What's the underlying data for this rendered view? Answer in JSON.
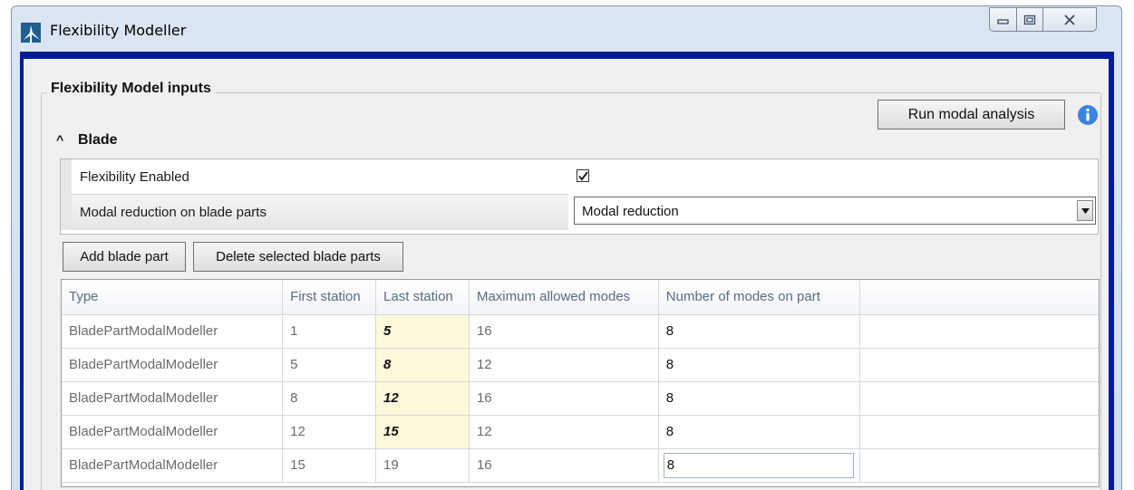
{
  "window": {
    "title": "Flexibility Modeller",
    "accent_color": "#001aa0"
  },
  "inputs": {
    "group_title": "Flexibility Model inputs",
    "run_button": "Run modal analysis",
    "section_title": "Blade",
    "properties": [
      {
        "label": "Flexibility Enabled",
        "checked": true
      },
      {
        "label": "Modal reduction on blade parts",
        "value": "Modal reduction"
      }
    ]
  },
  "toolbar": {
    "add_label": "Add blade part",
    "delete_label": "Delete selected blade parts"
  },
  "grid": {
    "headers": [
      "Type",
      "First station",
      "Last station",
      "Maximum allowed modes",
      "Number of modes on part"
    ],
    "rows": [
      {
        "type": "BladePartModalModeller",
        "first": "1",
        "last": "5",
        "max": "16",
        "modes": "8"
      },
      {
        "type": "BladePartModalModeller",
        "first": "5",
        "last": "8",
        "max": "12",
        "modes": "8"
      },
      {
        "type": "BladePartModalModeller",
        "first": "8",
        "last": "12",
        "max": "16",
        "modes": "8"
      },
      {
        "type": "BladePartModalModeller",
        "first": "12",
        "last": "15",
        "max": "12",
        "modes": "8"
      },
      {
        "type": "BladePartModalModeller",
        "first": "15",
        "last": "19",
        "max": "16",
        "modes": "8"
      }
    ]
  }
}
